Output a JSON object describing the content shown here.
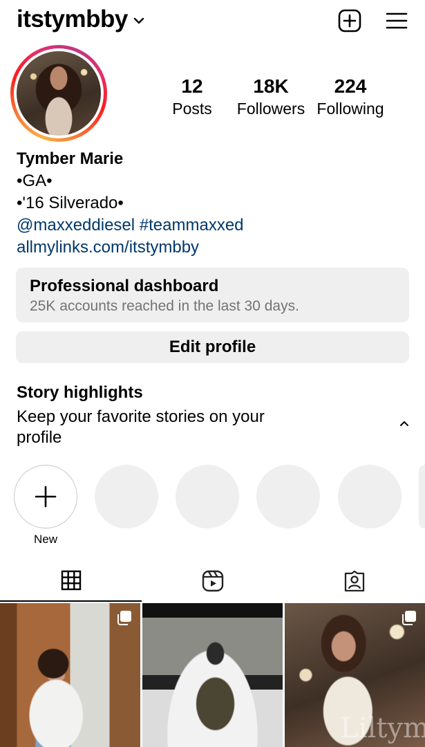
{
  "header": {
    "username": "itstymbby",
    "icons": [
      "chevron-down-icon",
      "new-post-icon",
      "hamburger-menu-icon"
    ]
  },
  "stats": {
    "posts": {
      "value": "12",
      "label": "Posts"
    },
    "followers": {
      "value": "18K",
      "label": "Followers"
    },
    "following": {
      "value": "224",
      "label": "Following"
    }
  },
  "bio": {
    "name": "Tymber Marie",
    "line1": "•GA•",
    "line2": "•'16 Silverado•",
    "tags": "@maxxeddiesel #teammaxxed",
    "link": "allmylinks.com/itstymbby"
  },
  "dashboard": {
    "title": "Professional dashboard",
    "subtitle": "25K accounts reached in the last 30 days."
  },
  "edit_profile_label": "Edit profile",
  "highlights": {
    "title": "Story highlights",
    "subtitle": "Keep your favorite stories on your profile",
    "new_label": "New"
  },
  "tabs": [
    "grid-icon",
    "reels-icon",
    "tagged-icon"
  ],
  "posts": [
    {
      "icon": "multiple-photos-icon"
    },
    {
      "icon": ""
    },
    {
      "icon": "multiple-photos-icon",
      "watermark": "Liltym"
    }
  ],
  "colors": {
    "link": "#00376b",
    "button_bg": "#efefef",
    "secondary_text": "#737373"
  }
}
